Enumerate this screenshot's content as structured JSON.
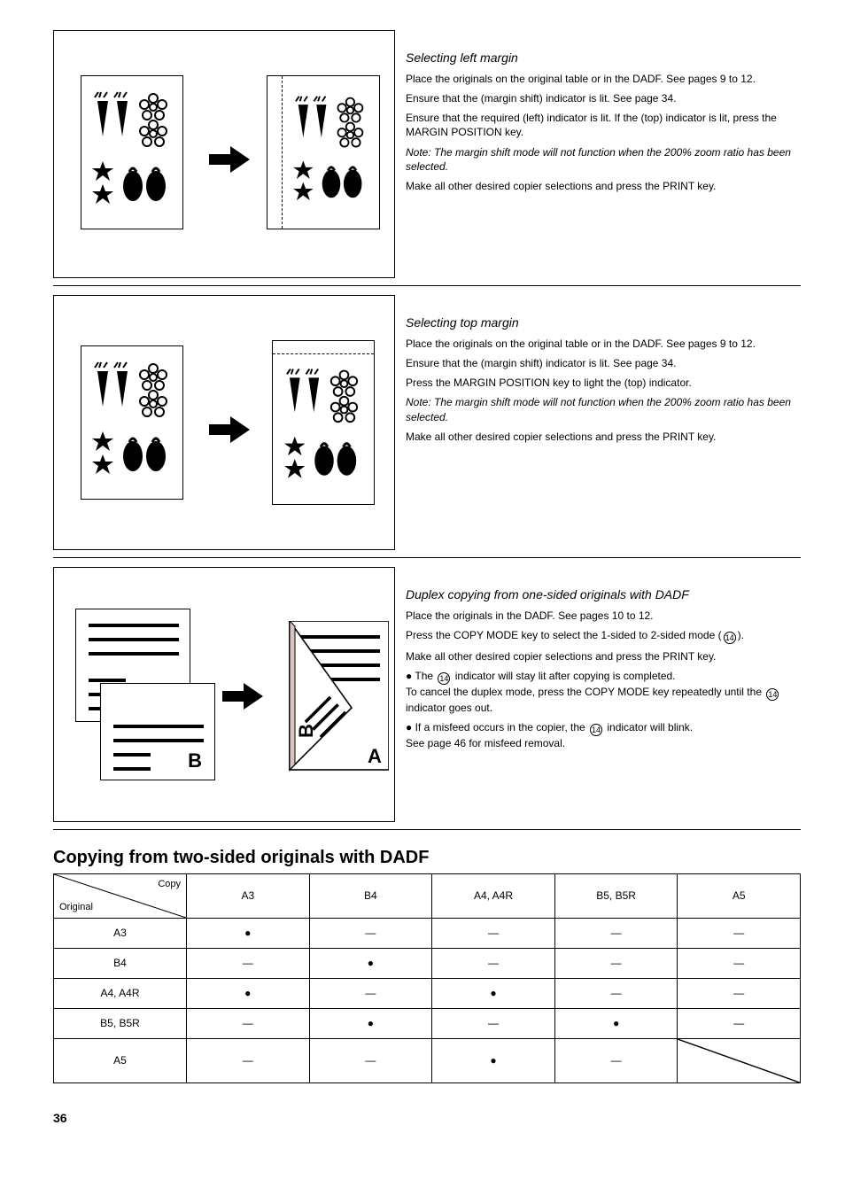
{
  "s1": {
    "title": "Selecting left margin",
    "p1": "Place the originals on the original table or in the DADF. See pages 9 to 12.",
    "p2": "Ensure that the (margin shift) indicator is lit. See page 34.",
    "p3": "Ensure that the required (left) indicator is lit. If the (top) indicator is lit, press the MARGIN POSITION key.",
    "note_label": "Note:",
    "note": "The margin shift mode will not function when the 200% zoom ratio has been selected.",
    "p4": "Make all other desired copier selections and press the PRINT key."
  },
  "s2": {
    "title": "Selecting top margin",
    "p1": "Place the originals on the original table or in the DADF. See pages 9 to 12.",
    "p2": "Ensure that the (margin shift) indicator is lit. See page 34.",
    "p3": "Press the MARGIN POSITION key to light the (top) indicator.",
    "note_label": "Note:",
    "note": "The margin shift mode will not function when the 200% zoom ratio has been selected.",
    "p4": "Make all other desired copier selections and press the PRINT key."
  },
  "s3": {
    "title": "Duplex copying from one-sided originals with DADF",
    "p1": "Place the originals in the DADF. See pages 10 to 12.",
    "p2a": "Press the COPY MODE key to select the 1-sided to 2-sided mode (",
    "p2b": ").",
    "p3": "Make all other desired copier selections and press the PRINT key.",
    "note1_a": "● The",
    "note1_b": "indicator will stay lit after copying is completed.",
    "note1_c": "To cancel the duplex mode, press the COPY MODE key repeatedly until the ",
    "note1_d": "indicator goes out.",
    "note2_a": "● If a misfeed occurs in the copier, the ",
    "note2_b": " indicator will blink.",
    "note2_c": "See page 46 for misfeed removal.",
    "circ": "14"
  },
  "heading": "Copying from two-sided originals with DADF",
  "table": {
    "headers": [
      "Copy",
      "Original",
      "A3",
      "B4",
      "A4, A4R",
      "B5, B5R",
      "A5"
    ],
    "rows": [
      [
        "A3",
        "●",
        "—",
        "—",
        "—",
        "—"
      ],
      [
        "B4",
        "—",
        "●",
        "—",
        "—",
        "—"
      ],
      [
        "A4, A4R",
        "●",
        "—",
        "●",
        "—",
        "—"
      ],
      [
        "B5, B5R",
        "—",
        "●",
        "—",
        "●",
        "—"
      ],
      [
        "A5",
        "—",
        "—",
        "●",
        "—",
        ""
      ]
    ]
  },
  "page": "36"
}
